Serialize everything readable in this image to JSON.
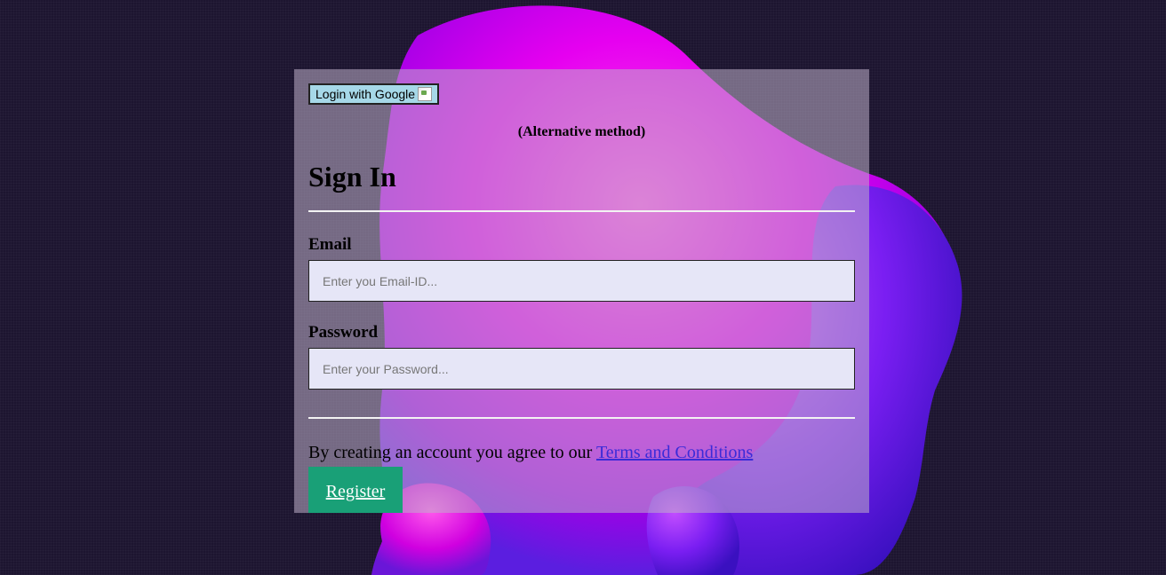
{
  "login": {
    "google_button_label": "Login with Google",
    "alternative_text": "(Alternative method)",
    "title": "Sign In",
    "email_label": "Email",
    "email_placeholder": "Enter you Email-ID...",
    "email_value": "",
    "password_label": "Password",
    "password_placeholder": "Enter your Password...",
    "password_value": "",
    "agreement_text": "By creating an account you agree to our ",
    "terms_link": "Terms and Conditions",
    "register_label": "Register"
  },
  "colors": {
    "page_background": "#1d1530",
    "card_overlay": "#bfaec8",
    "google_button": "#a6d8e8",
    "input_background": "#e6e6f7",
    "register_button": "#19a077",
    "link": "#3b2bd8",
    "blob_magenta": "#e600f0",
    "blob_violet": "#5b1ee0"
  },
  "icons": {
    "google_image": "broken-image-icon"
  }
}
